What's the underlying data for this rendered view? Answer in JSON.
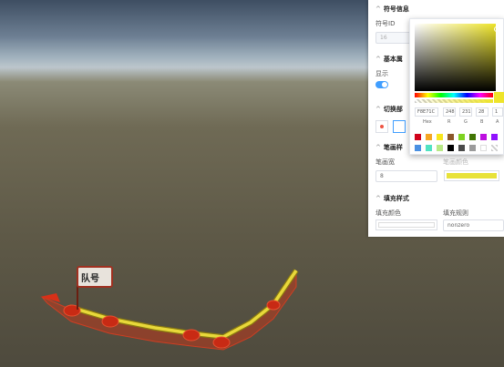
{
  "panel": {
    "symbol_info": {
      "title": "符号信息",
      "id_label": "符号ID",
      "id_value": "16"
    },
    "basic": {
      "title": "基本属",
      "display_label": "显示"
    },
    "switch": {
      "title": "切换部"
    },
    "pen_style": {
      "title": "笔画样",
      "width_label": "笔画宽",
      "width_value": "8",
      "color_label": "笔画颜色"
    },
    "fill_style": {
      "title": "填充样式",
      "fill_color_label": "填充颜色",
      "fill_rule_label": "填充规则",
      "fill_rule_value": "nonzero"
    }
  },
  "picker": {
    "hex": "F8E71C",
    "r": "248",
    "g": "231",
    "b": "28",
    "a": "1",
    "hex_label": "Hex",
    "r_label": "R",
    "g_label": "G",
    "b_label": "B",
    "a_label": "A",
    "preview_color": "#eee42a",
    "swatches": [
      "#d0021b",
      "#f5a623",
      "#f8e71c",
      "#8b572a",
      "#7ed321",
      "#417505",
      "#bd10e0",
      "#9013fe",
      "#4a90e2",
      "#50e3c2",
      "#b8e986",
      "#000000",
      "#4a4a4a",
      "#9b9b9b",
      "#ffffff",
      "transparent"
    ]
  },
  "scene": {
    "flag_text": "队号"
  },
  "colors": {
    "accent": "#409eff",
    "stroke": "#e8e23a",
    "route_red": "#d8331a"
  }
}
